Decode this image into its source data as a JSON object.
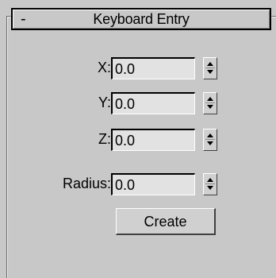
{
  "rollout": {
    "collapse_symbol": "-",
    "title": "Keyboard Entry"
  },
  "fields": [
    {
      "label": "X:",
      "value": "0.0"
    },
    {
      "label": "Y:",
      "value": "0.0"
    },
    {
      "label": "Z:",
      "value": "0.0"
    },
    {
      "label": "Radius:",
      "value": "0.0"
    }
  ],
  "create_button": {
    "label": "Create"
  }
}
